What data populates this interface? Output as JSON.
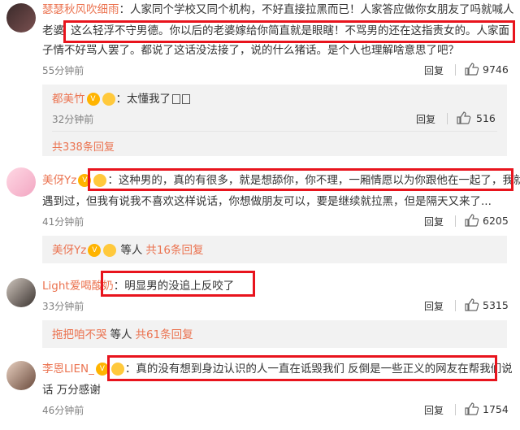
{
  "comments": [
    {
      "user": "瑟瑟秋风吹细雨",
      "text_line1": "：人家同个学校又同个机构，不好直接拉黑而已！人家答应做你女朋友了吗就喊人",
      "text_line2_a": "老婆",
      "text_line2_b": "这么轻浮不守男德。你以后的老婆嫁给你简直就是眼瞎！不骂男的还在这指责女的。人家面",
      "text_line3": "子情不好骂人罢了。都说了这话没法接了，说的什么猪话。是个人也理解啥意思了吧？",
      "time": "55分钟前",
      "reply": "回复",
      "likes": "9746"
    },
    {
      "user": "都美竹",
      "text": "：太懂我了",
      "time": "32分钟前",
      "reply": "回复",
      "likes": "516",
      "is_sub": true
    },
    {
      "more": "共338条回复"
    },
    {
      "user": "美伢Yz",
      "text_line1": "：这种男的，真的有很多，就是想舔你，你不理，一厢情愿以为你跟他在一起了，我就",
      "text_line2": "遇到过，但我有说我不喜欢这样说话，你想做朋友可以，要是继续就拉黑，但是隔天又来了...",
      "time": "41分钟前",
      "reply": "回复",
      "likes": "6205"
    },
    {
      "sub_user": "美伢Yz",
      "sub_mid": "等人",
      "more": "共16条回复"
    },
    {
      "user": "Light爱喝酸奶",
      "text": "：明显男的没追上反咬了",
      "time": "33分钟前",
      "reply": "回复",
      "likes": "5315"
    },
    {
      "sub_user": "拖把咱不哭",
      "sub_mid": "等人",
      "more": "共61条回复"
    },
    {
      "user": "李恩LIEN_",
      "text_line1": "：真的没有想到身边认识的人一直在诋毁我们 反倒是一些正义的网友在帮我们说",
      "text_line2": "话 万分感谢",
      "time": "46分钟前",
      "reply": "回复",
      "likes": "1754"
    }
  ],
  "icons": {
    "like": "thumbs-up-icon",
    "vip": "vip-badge-icon",
    "emoji": "smile-emoji-icon"
  },
  "colors": {
    "name": "#eb7350",
    "highlight_box": "#e8141d",
    "sub_bg": "#f2f2f2"
  }
}
